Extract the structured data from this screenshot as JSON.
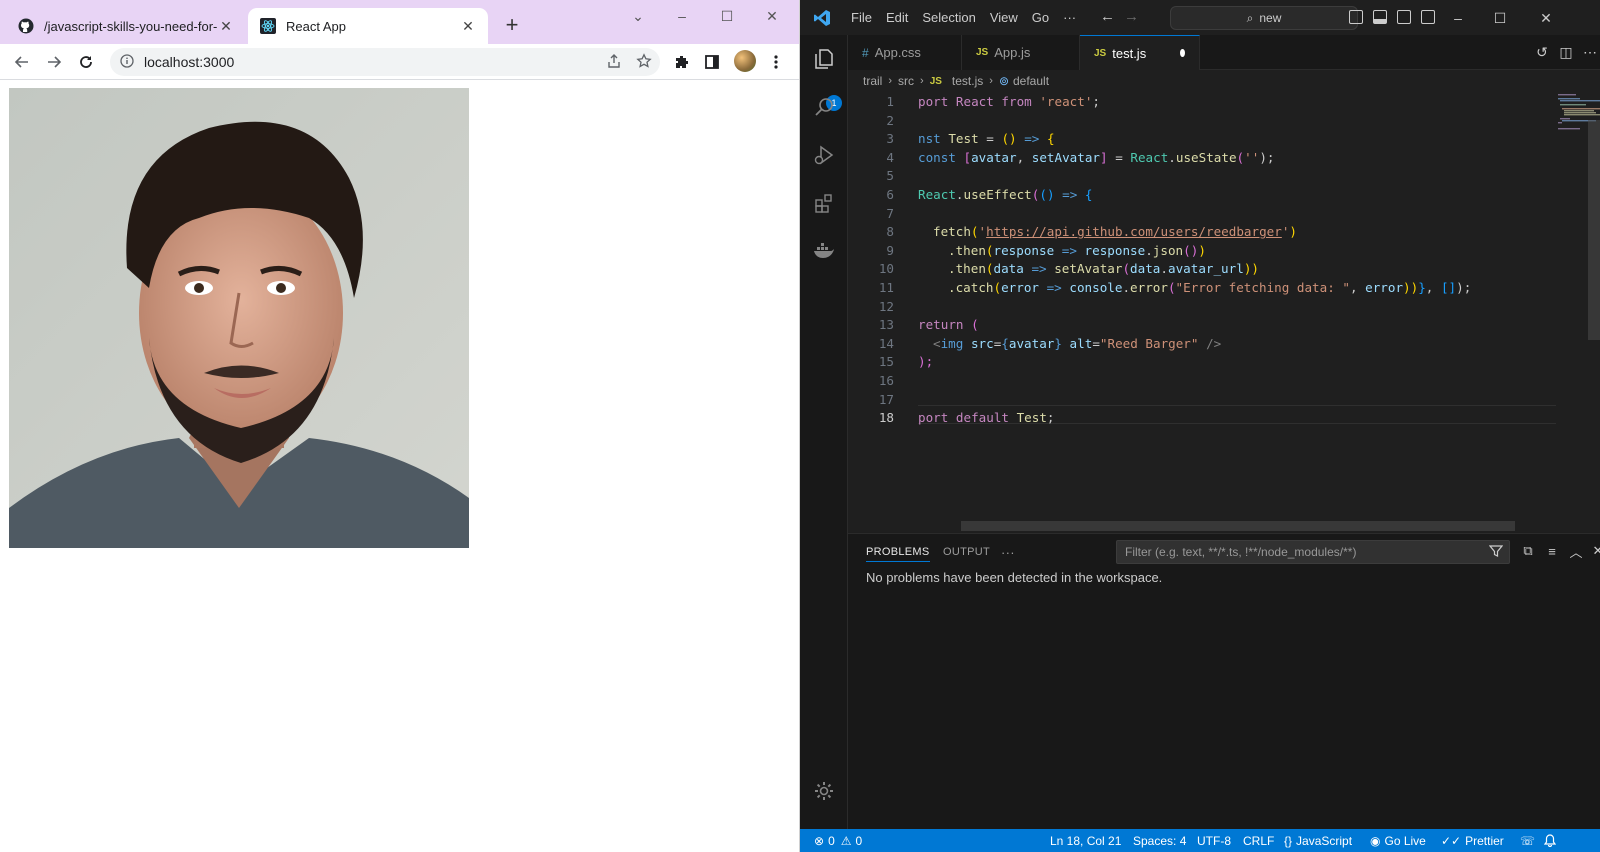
{
  "browser": {
    "tabs": [
      {
        "title": "/javascript-skills-you-need-for-re",
        "icon": "github-icon"
      },
      {
        "title": "React App",
        "icon": "react-icon",
        "active": true
      }
    ],
    "address": "localhost:3000",
    "page_image_alt": "Reed Barger"
  },
  "vscode": {
    "menu": [
      "File",
      "Edit",
      "Selection",
      "View",
      "Go",
      "···"
    ],
    "command_center": "new",
    "editor_tabs": [
      {
        "label": "App.css",
        "icon": "#"
      },
      {
        "label": "App.js",
        "icon": "JS"
      },
      {
        "label": "test.js",
        "icon": "JS",
        "active": true,
        "modified": true
      }
    ],
    "breadcrumb": [
      "trail",
      "src",
      "test.js",
      "default"
    ],
    "explorer_badge": "1",
    "line_numbers": [
      "1",
      "2",
      "3",
      "4",
      "5",
      "6",
      "7",
      "8",
      "9",
      "10",
      "11",
      "12",
      "13",
      "14",
      "15",
      "16",
      "17",
      "18"
    ],
    "code": {
      "l1_a": "port React from ",
      "l1_b": "'react'",
      "l1_c": ";",
      "l3_a": "nst ",
      "l3_b": "Test",
      "l3_c": " = ",
      "l3_d": "() ",
      "l3_e": "=>",
      "l3_f": " {",
      "l4_a": "const ",
      "l4_b": "[",
      "l4_c": "avatar",
      "l4_d": ", ",
      "l4_e": "setAvatar",
      "l4_f": "]",
      "l4_g": " = ",
      "l4_h": "React",
      "l4_i": ".",
      "l4_j": "useState",
      "l4_k": "(",
      "l4_l": "''",
      "l4_m": ");",
      "l6_a": "React",
      "l6_b": ".",
      "l6_c": "useEffect",
      "l6_d": "(",
      "l6_e": "() ",
      "l6_f": "=>",
      "l6_g": " {",
      "l8_a": "fetch",
      "l8_b": "(",
      "l8_c": "'",
      "l8_d": "https://api.github.com/users/reedbarger",
      "l8_e": "'",
      "l8_f": ")",
      "l9_a": ".then",
      "l9_b": "(",
      "l9_c": "response",
      "l9_d": " => ",
      "l9_e": "response",
      "l9_f": ".",
      "l9_g": "json",
      "l9_h": "()",
      "l9_i": ")",
      "l10_a": ".then",
      "l10_b": "(",
      "l10_c": "data",
      "l10_d": " => ",
      "l10_e": "setAvatar",
      "l10_f": "(",
      "l10_g": "data",
      "l10_h": ".",
      "l10_i": "avatar_url",
      "l10_j": "))",
      "l11_a": ".catch",
      "l11_b": "(",
      "l11_c": "error",
      "l11_d": " => ",
      "l11_e": "console",
      "l11_f": ".",
      "l11_g": "error",
      "l11_h": "(",
      "l11_i": "\"Error fetching data: \"",
      "l11_j": ", ",
      "l11_k": "error",
      "l11_l": "))",
      "l11_m": "}",
      "l11_n": ", ",
      "l11_o": "[]",
      "l11_p": ");",
      "l13_a": "return ",
      "l13_b": "(",
      "l14_a": "<",
      "l14_b": "img ",
      "l14_c": "src",
      "l14_d": "=",
      "l14_e": "{",
      "l14_f": "avatar",
      "l14_g": "}",
      "l14_h": " alt",
      "l14_i": "=",
      "l14_j": "\"Reed Barger\"",
      "l14_k": " />",
      "l15_a": ");",
      "l18_a": "port default ",
      "l18_b": "Test",
      "l18_c": ";"
    },
    "panel": {
      "tabs": [
        "PROBLEMS",
        "OUTPUT",
        "···"
      ],
      "filter_placeholder": "Filter (e.g. text, **/*.ts, !**/node_modules/**)",
      "message": "No problems have been detected in the workspace."
    },
    "status": {
      "errors": "0",
      "warnings": "0",
      "position": "Ln 18, Col 21",
      "spaces": "Spaces: 4",
      "encoding": "UTF-8",
      "eol": "CRLF",
      "language": "JavaScript",
      "golive": "Go Live",
      "prettier": "Prettier"
    },
    "colors": {
      "accent": "#0078d4",
      "editor_bg": "#1f1f1f",
      "chrome_tabbar": "#e8d4f5"
    }
  }
}
